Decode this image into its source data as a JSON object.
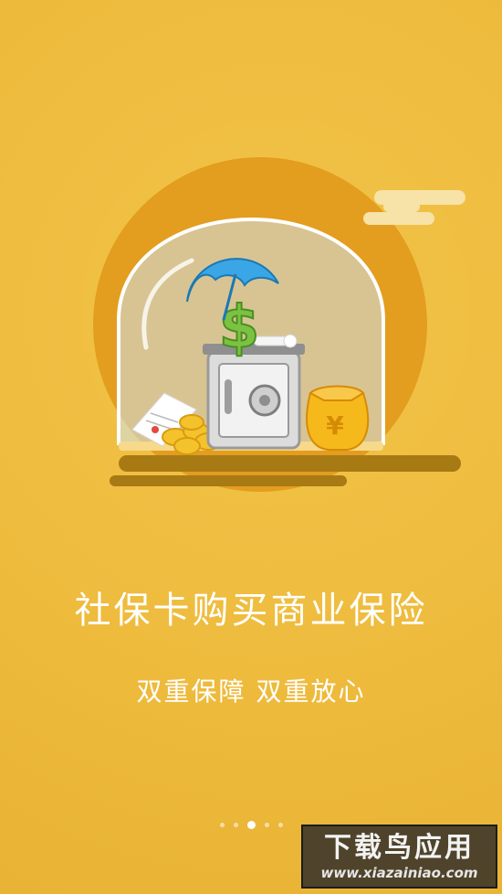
{
  "screen": {
    "title": "社保卡购买商业保险",
    "subtitle": "双重保障  双重放心"
  },
  "pager": {
    "count": 5,
    "active": 3
  },
  "watermark": {
    "main": "下载鸟应用",
    "url": "www.xiazainiao.com"
  },
  "illustration": {
    "safe_symbol": "$",
    "bag_symbol": "¥"
  },
  "colors": {
    "background": "#efbd3f",
    "circle": "#e39d1f",
    "shadow": "#a77a14",
    "text": "#ffffff"
  }
}
